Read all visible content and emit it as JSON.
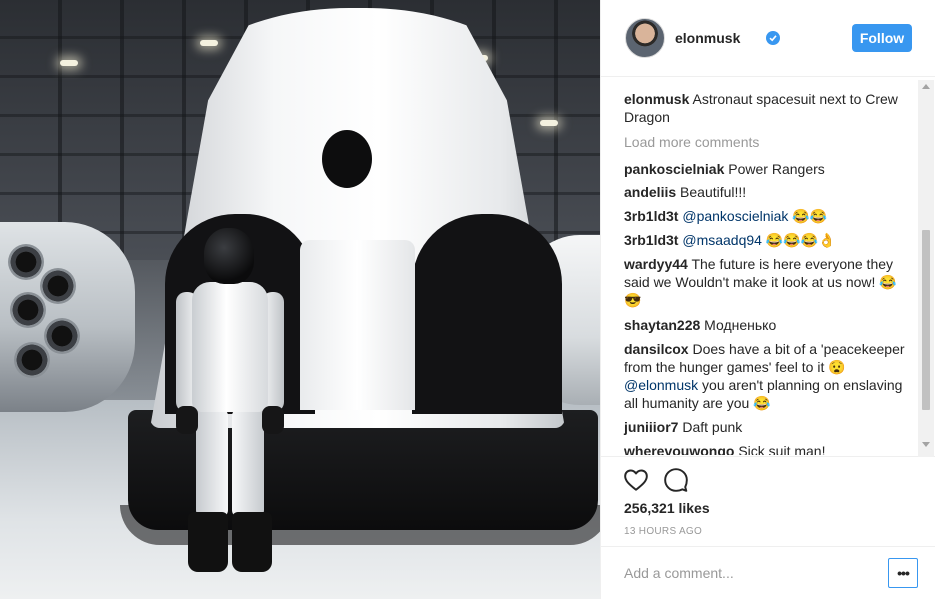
{
  "post": {
    "image_alt": "Astronaut spacesuit next to Crew Dragon",
    "author": "elonmusk",
    "verified_icon": "verified-badge-icon",
    "follow_label": "Follow"
  },
  "caption": {
    "user": "elonmusk",
    "text": " Astronaut spacesuit next to Crew Dragon"
  },
  "load_more_label": "Load more comments",
  "comments": [
    {
      "user": "pankoscielniak",
      "text": " Power Rangers"
    },
    {
      "user": "andeliis",
      "text": " Beautiful!!!"
    },
    {
      "user": "3rb1ld3t",
      "mention": "@pankoscielniak",
      "text": " 😂😂"
    },
    {
      "user": "3rb1ld3t",
      "mention": "@msaadq94",
      "text": " 😂😂😂👌"
    },
    {
      "user": "wardyy44",
      "text": " The future is here everyone they said we Wouldn't make it look at us now! 😂😎"
    },
    {
      "user": "shaytan228",
      "text": " Модненько"
    },
    {
      "user": "dansilcox",
      "text": " Does have a bit of a 'peacekeeper from the hunger games' feel to it 😧 ",
      "mention": "@elonmusk",
      "text_after": " you aren't planning on enslaving all humanity are you 😂"
    },
    {
      "user": "juniiior7",
      "text": " Daft punk"
    },
    {
      "user": "wherevouwongo",
      "text": " Sick suit man!"
    }
  ],
  "actions": {
    "like_icon": "heart-icon",
    "comment_icon": "comment-icon",
    "likes": "256,321 likes",
    "timestamp": "13 HOURS AGO"
  },
  "add_comment": {
    "placeholder": "Add a comment...",
    "more_label": "•••",
    "more_icon": "more-options-icon"
  }
}
